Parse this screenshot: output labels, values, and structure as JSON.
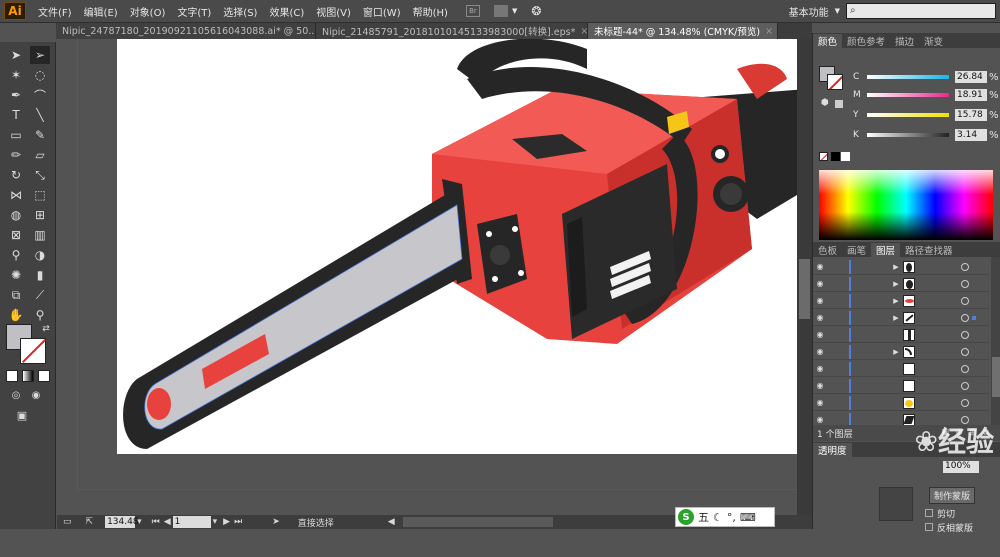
{
  "app": {
    "logo": "Ai"
  },
  "menu": [
    "文件(F)",
    "编辑(E)",
    "对象(O)",
    "文字(T)",
    "选择(S)",
    "效果(C)",
    "视图(V)",
    "窗口(W)",
    "帮助(H)"
  ],
  "header": {
    "workspace": "基本功能",
    "search_placeholder": ""
  },
  "tabs": [
    {
      "label": "Nipic_24787180_20190921105616043088.ai* @ 50...",
      "close": "×",
      "active": false
    },
    {
      "label": "Nipic_21485791_20181010145133983000[转换].eps*",
      "close": "×",
      "active": false
    },
    {
      "label": "未标题-44* @ 134.48% (CMYK/预览)",
      "close": "×",
      "active": true
    }
  ],
  "color_panel": {
    "tabs": [
      "颜色",
      "颜色参考",
      "描边",
      "渐变"
    ],
    "active_tab": "颜色",
    "sliders": [
      {
        "label": "C",
        "value": "26.84",
        "color": "#19b5e8"
      },
      {
        "label": "M",
        "value": "18.91",
        "color": "#e8288e"
      },
      {
        "label": "Y",
        "value": "15.78",
        "color": "#f0e100"
      },
      {
        "label": "K",
        "value": "3.14",
        "color": "#222222"
      }
    ],
    "unit": "%"
  },
  "layers_panel": {
    "tabs": [
      "色板",
      "画笔",
      "图层",
      "路径查找器"
    ],
    "active_tab": "图层",
    "rows": [
      {
        "expandable": true,
        "thumb": "dark-oval"
      },
      {
        "expandable": true,
        "thumb": "dark-oval"
      },
      {
        "expandable": true,
        "thumb": "red-blob"
      },
      {
        "expandable": true,
        "thumb": "dark-stripe"
      },
      {
        "expandable": false,
        "thumb": "dark-bar"
      },
      {
        "expandable": true,
        "thumb": "curve"
      },
      {
        "expandable": false,
        "thumb": "blank"
      },
      {
        "expandable": false,
        "thumb": "blank"
      },
      {
        "expandable": false,
        "thumb": "yellow"
      },
      {
        "expandable": false,
        "thumb": "dark-shape"
      }
    ],
    "footer": "1 个图层"
  },
  "lower_panel": {
    "tab": "透明度",
    "value": "100%",
    "button": "制作蒙版",
    "items": [
      "剪切",
      "反相蒙版"
    ]
  },
  "status": {
    "zoom": "134.48",
    "page": "1",
    "tool": "直接选择"
  },
  "ime": {
    "logo": "S",
    "mode": "五"
  },
  "watermark": "经验"
}
